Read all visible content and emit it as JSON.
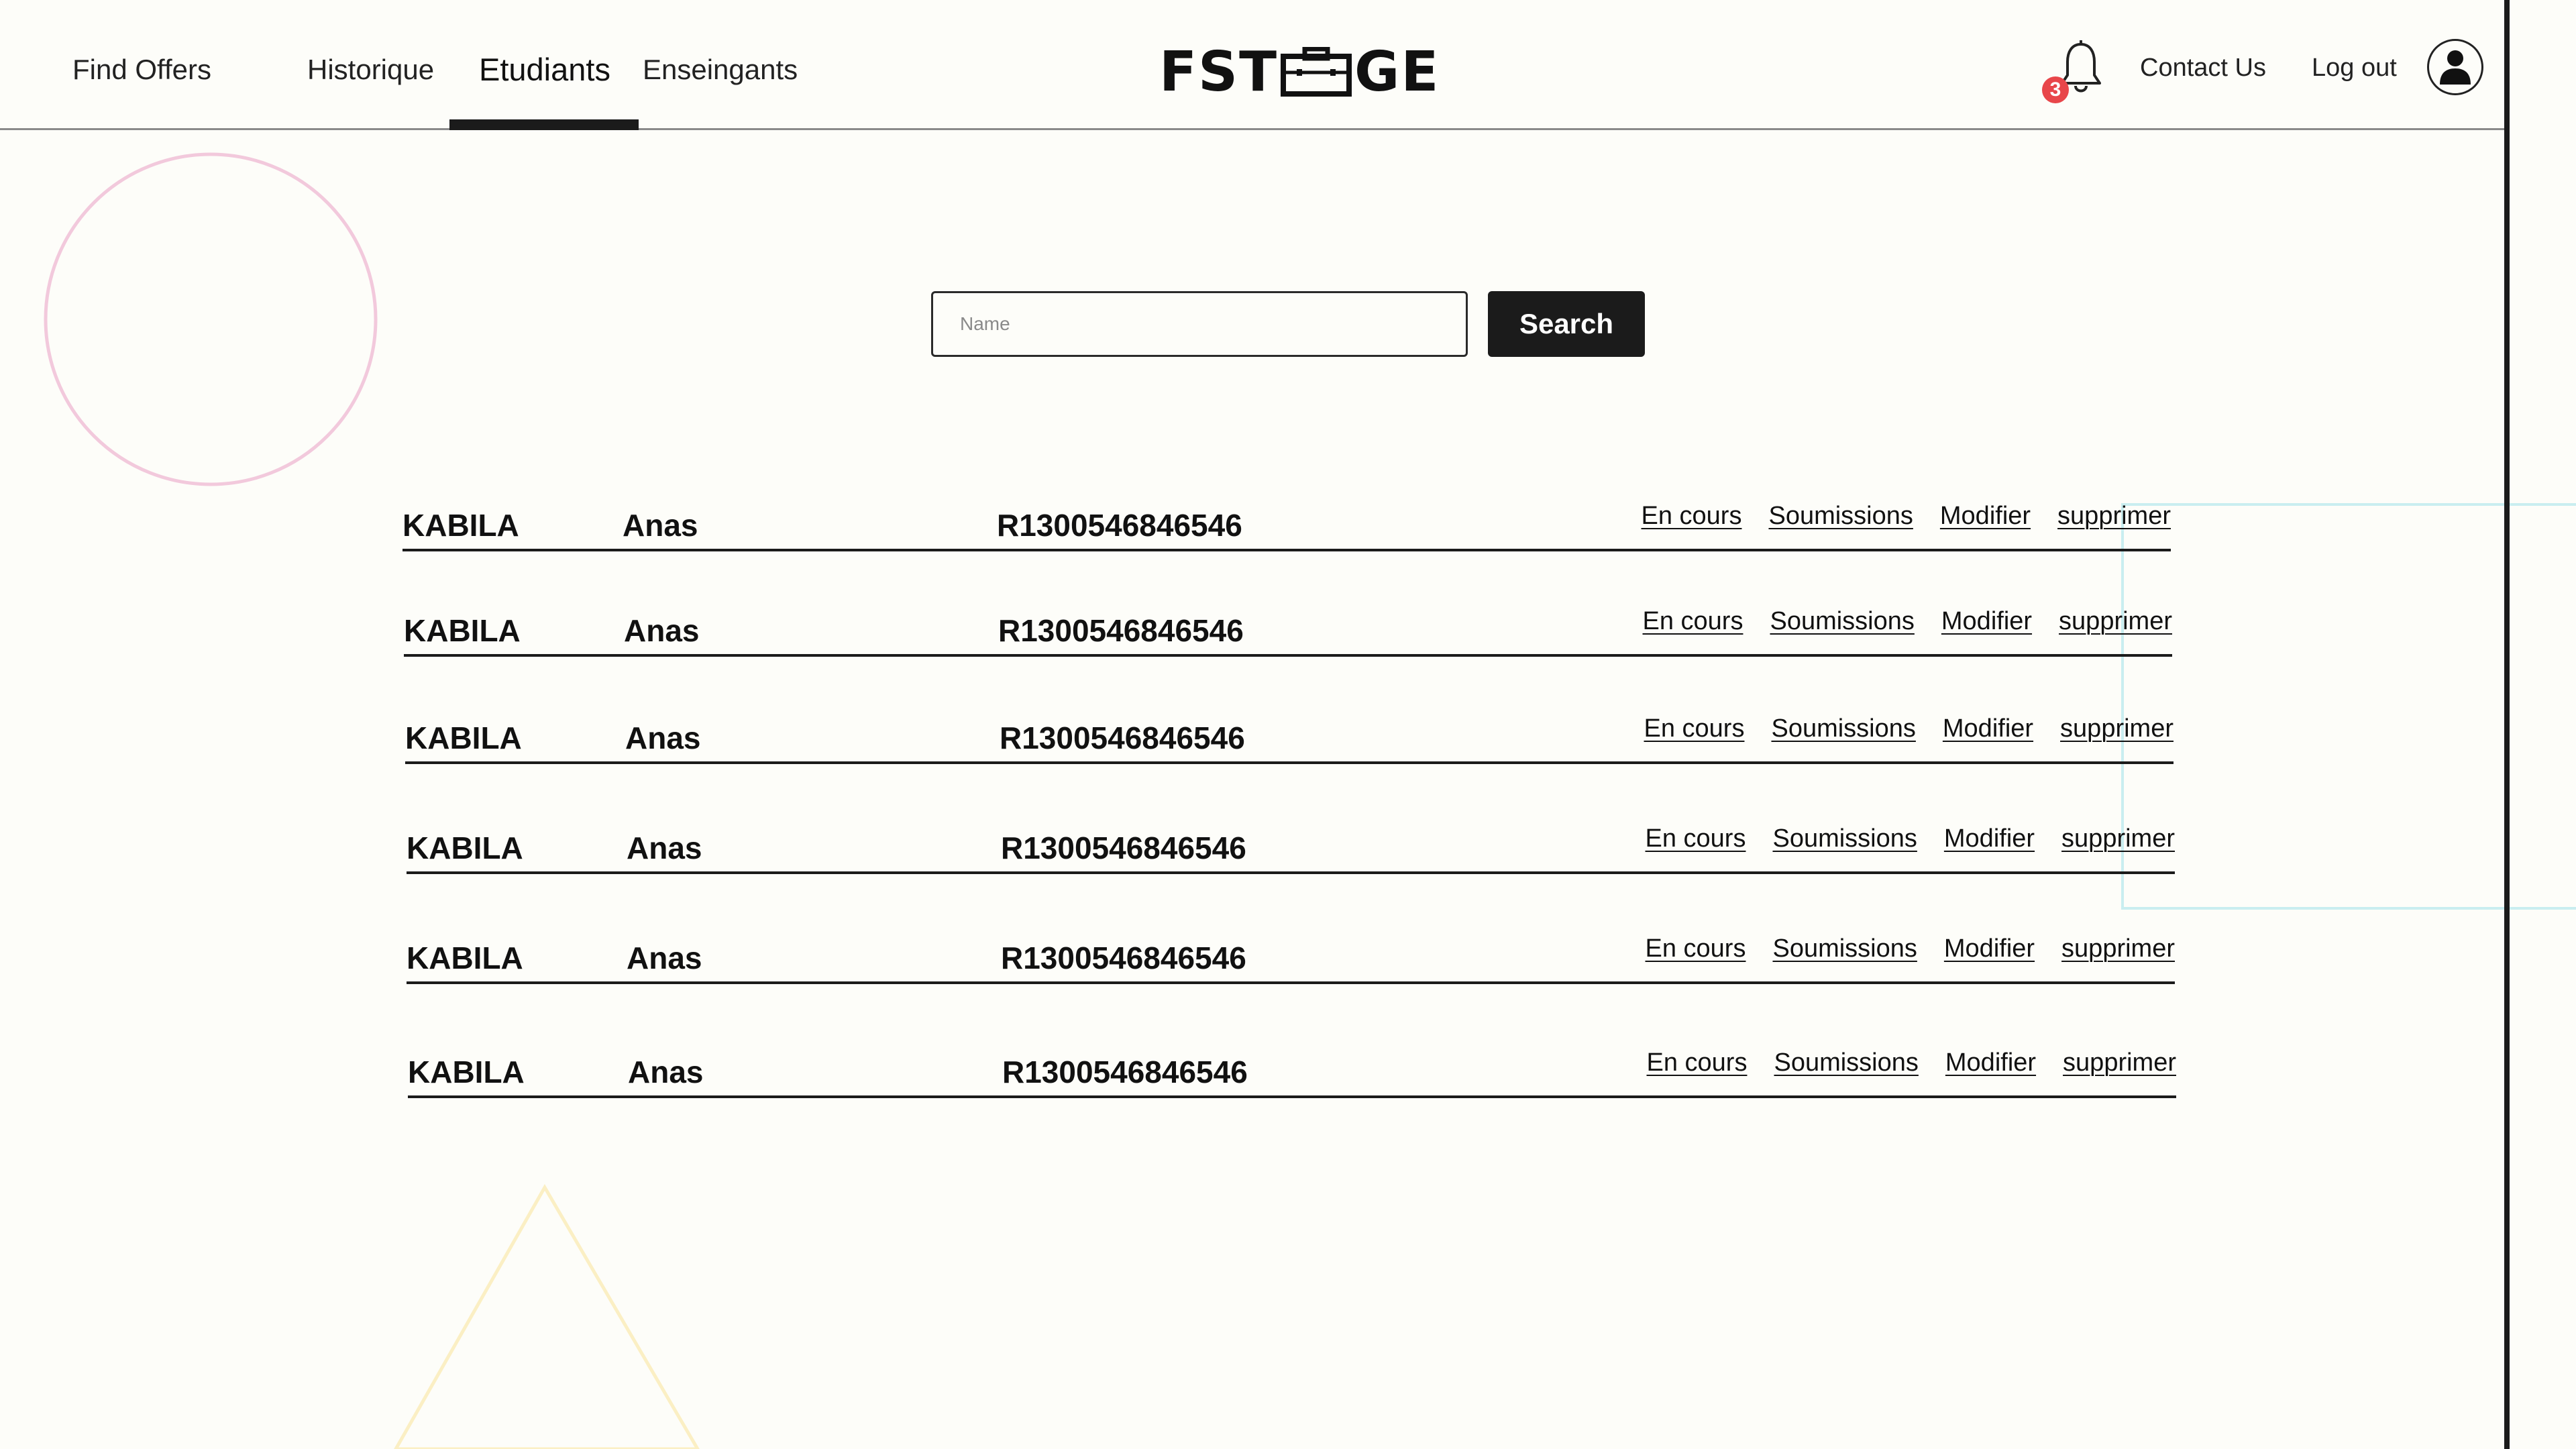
{
  "nav": {
    "find_offers": "Find Offers",
    "historique": "Historique",
    "etudiants": "Etudiants",
    "enseignants": "Enseingants"
  },
  "logo": {
    "left": "FST",
    "right": "GE"
  },
  "notifications": {
    "count": "3"
  },
  "header_links": {
    "contact": "Contact Us",
    "logout": "Log out"
  },
  "search": {
    "placeholder": "Name",
    "value": "",
    "button_label": "Search"
  },
  "students": [
    {
      "last_name": "KABILA",
      "first_name": "Anas",
      "id": "R1300546846546"
    },
    {
      "last_name": "KABILA",
      "first_name": "Anas",
      "id": "R1300546846546"
    },
    {
      "last_name": "KABILA",
      "first_name": "Anas",
      "id": "R1300546846546"
    },
    {
      "last_name": "KABILA",
      "first_name": "Anas",
      "id": "R1300546846546"
    },
    {
      "last_name": "KABILA",
      "first_name": "Anas",
      "id": "R1300546846546"
    },
    {
      "last_name": "KABILA",
      "first_name": "Anas",
      "id": "R1300546846546"
    }
  ],
  "row_actions": {
    "en_cours": "En cours",
    "soumissions": "Soumissions",
    "modifier": "Modifier",
    "supprimer": "supprimer"
  },
  "colors": {
    "accent_dark": "#1b1b1b",
    "badge": "#e8464a",
    "deco_circle": "#f2c9dc",
    "deco_square": "#c9eef0",
    "deco_triangle": "#fbefc4"
  }
}
